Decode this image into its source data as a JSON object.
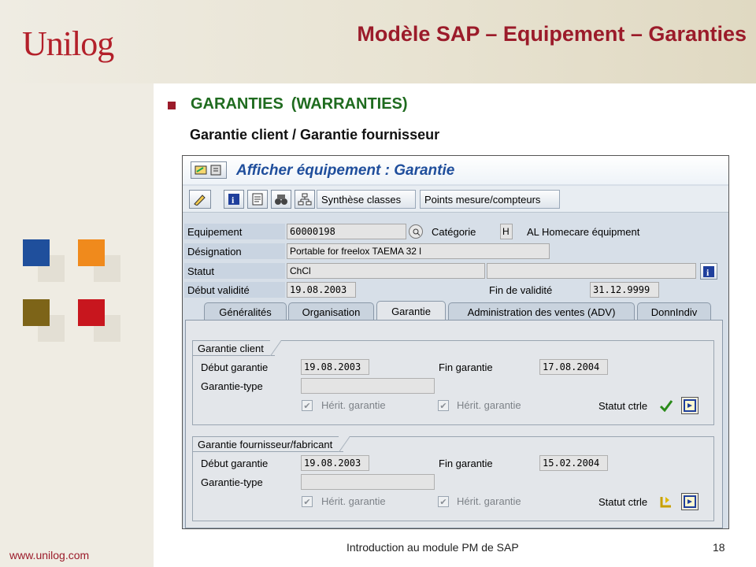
{
  "slide": {
    "logo": "Unilog",
    "title": "Modèle SAP – Equipement – Garanties",
    "heading_main": "GARANTIES",
    "heading_paren": "(WARRANTIES)",
    "subheading": "Garantie client / Garantie fournisseur",
    "footer_url": "www.unilog.com",
    "footer_title": "Introduction au module PM de SAP",
    "page_number": "18",
    "colors": {
      "accent": "#9b1b2a",
      "heading": "#1f6b1f"
    }
  },
  "sap": {
    "title": "Afficher équipement : Garantie",
    "toolbar": {
      "synthese": "Synthèse classes",
      "points": "Points mesure/compteurs"
    },
    "header": {
      "equipement_label": "Equipement",
      "equipement_value": "60000198",
      "categorie_label": "Catégorie",
      "categorie_value": "H",
      "categorie_text": "AL Homecare équipment",
      "designation_label": "Désignation",
      "designation_value": "Portable for freelox TAEMA 32 l",
      "statut_label": "Statut",
      "statut_value": "ChCl",
      "debut_label": "Début validité",
      "debut_value": "19.08.2003",
      "fin_label": "Fin de validité",
      "fin_value": "31.12.9999"
    },
    "tabs": [
      "Généralités",
      "Organisation",
      "Garantie",
      "Administration des ventes (ADV)",
      "DonnIndiv"
    ],
    "active_tab": "Garantie",
    "client": {
      "title": "Garantie client",
      "debut_label": "Début garantie",
      "debut_value": "19.08.2003",
      "fin_label": "Fin garantie",
      "fin_value": "17.08.2004",
      "type_label": "Garantie-type",
      "type_value": "",
      "herit1": "Hérit. garantie",
      "herit2": "Hérit. garantie",
      "statut_label": "Statut ctrle"
    },
    "fournisseur": {
      "title": "Garantie fournisseur/fabricant",
      "debut_label": "Début garantie",
      "debut_value": "19.08.2003",
      "fin_label": "Fin garantie",
      "fin_value": "15.02.2004",
      "type_label": "Garantie-type",
      "type_value": "",
      "herit1": "Hérit. garantie",
      "herit2": "Hérit. garantie",
      "statut_label": "Statut ctrle"
    }
  }
}
